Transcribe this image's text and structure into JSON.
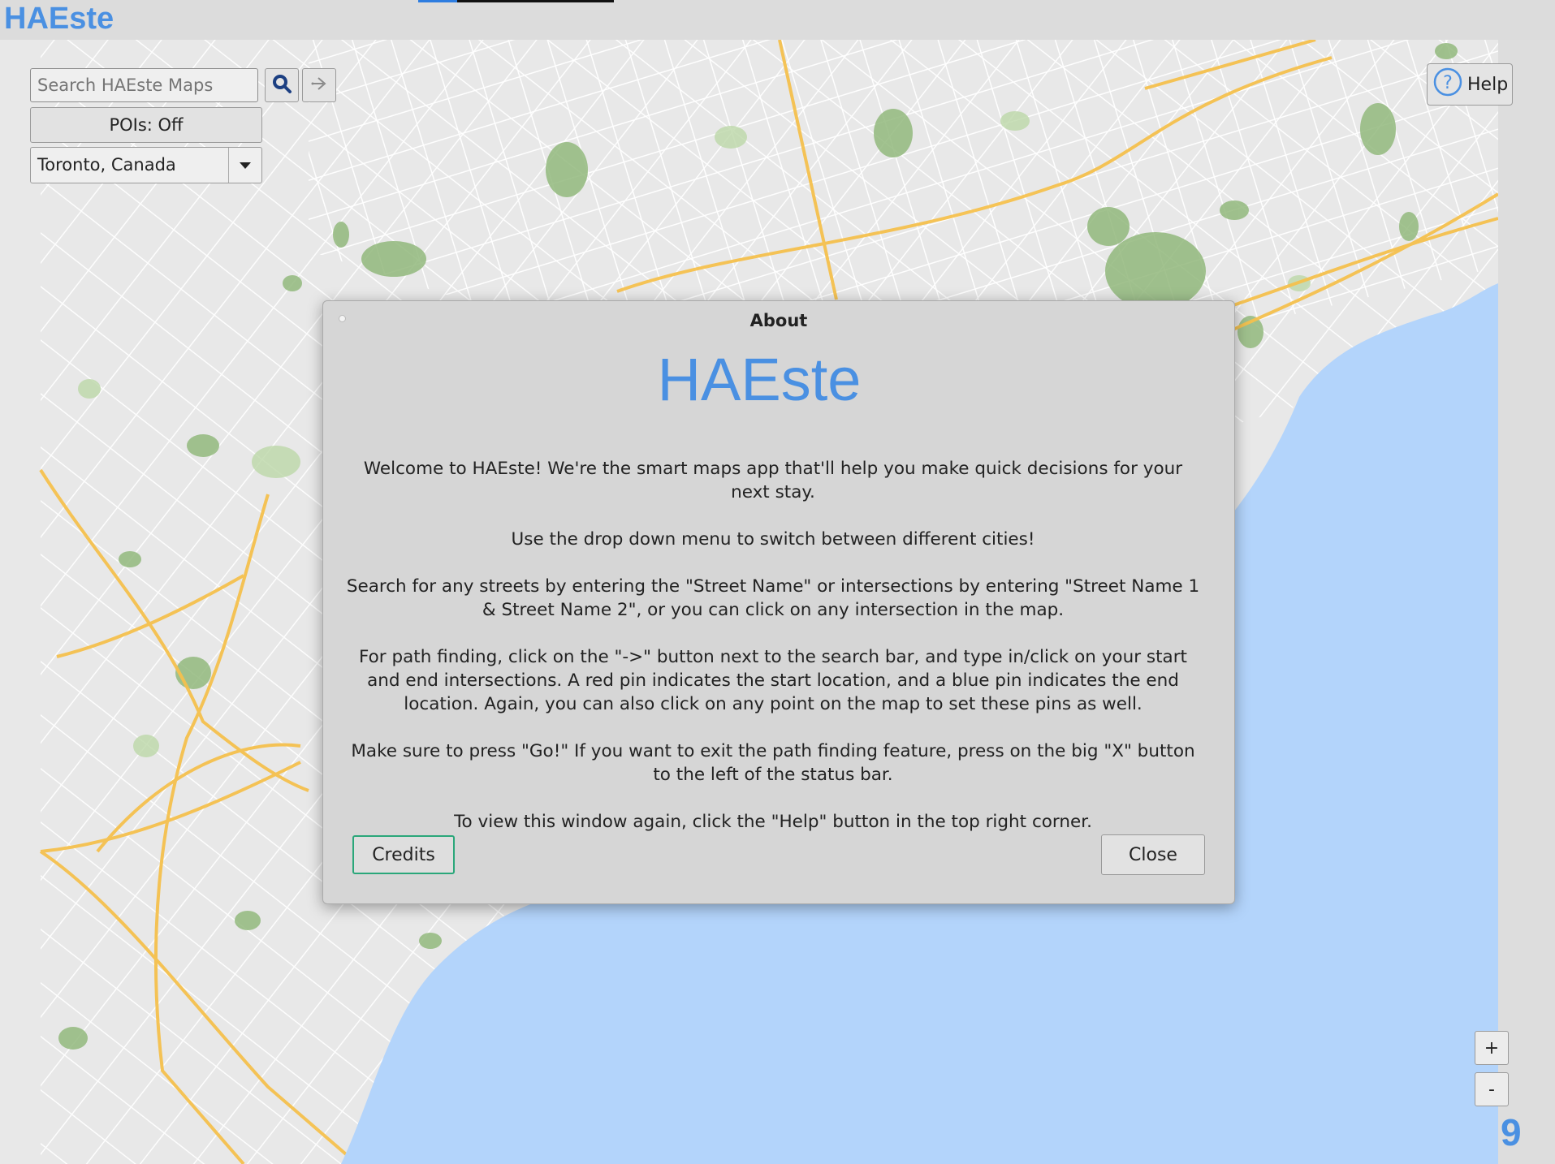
{
  "app": {
    "title": "HAEste"
  },
  "search": {
    "placeholder": "Search HAEste Maps"
  },
  "toolbar": {
    "pois_label": "POIs: Off",
    "city_selected": "Toronto, Canada",
    "help_label": "Help"
  },
  "zoom": {
    "in_label": "+",
    "out_label": "-"
  },
  "corner_number": "9",
  "dialog": {
    "title": "About",
    "heading": "HAEste",
    "paragraphs": [
      "Welcome to HAEste! We're the smart maps app that'll help you make quick decisions for your next stay.",
      "Use the drop down menu to switch between different cities!",
      "Search for any streets by entering the \"Street Name\" or intersections by entering \"Street Name 1 & Street Name 2\", or you can click on any intersection in the map.",
      "For path finding, click on the \"->\" button next to the search bar, and type in/click on your start and end intersections. A red pin indicates the start location, and a blue pin indicates the end location. Again, you can also click on any point on the map to set these pins as well.",
      "Make sure to press \"Go!\" If you want to exit the path finding feature, press on the big \"X\" button to the left of the status bar.",
      "To view this window again, click the \"Help\" button in the top right corner."
    ],
    "credits_label": "Credits",
    "close_label": "Close"
  },
  "colors": {
    "brand": "#4a90e2",
    "water": "#b3d4fb",
    "land": "#e8e8e8",
    "park": "#92b87c",
    "highway": "#f5c14e",
    "focus": "#2aa77a"
  }
}
